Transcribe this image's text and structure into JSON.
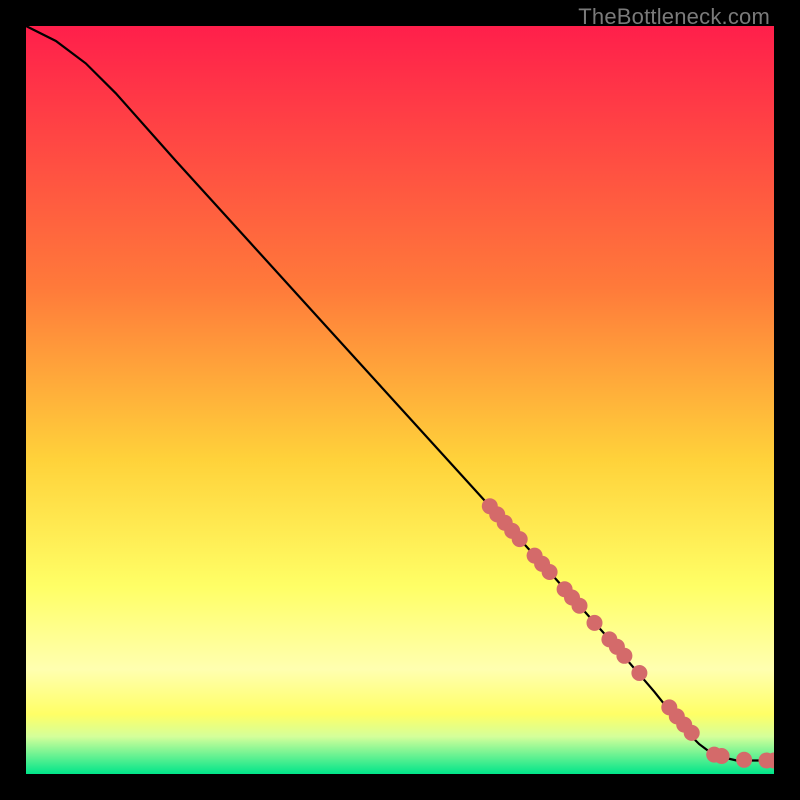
{
  "watermark": "TheBottleneck.com",
  "colors": {
    "top": "#ff1f4b",
    "mid1": "#ff7a3a",
    "mid2": "#ffd23a",
    "mid3": "#ffff66",
    "mid4": "#ffffb0",
    "edgeY": "#ffff66",
    "edgeG": "#d4ff9a",
    "bottom": "#00e58a",
    "line": "#000000",
    "marker": "#d46a6a"
  },
  "chart_data": {
    "type": "line",
    "title": "",
    "xlabel": "",
    "ylabel": "",
    "xlim": [
      0,
      100
    ],
    "ylim": [
      0,
      100
    ],
    "series": [
      {
        "name": "curve",
        "x": [
          0,
          4,
          8,
          12,
          20,
          30,
          40,
          50,
          60,
          70,
          78,
          84,
          88,
          90,
          92,
          95,
          100
        ],
        "y": [
          100,
          98,
          95,
          91,
          82,
          71,
          60,
          49,
          38,
          27,
          18,
          11,
          6,
          4,
          2.5,
          1.8,
          1.8
        ]
      }
    ],
    "markers": {
      "name": "segment",
      "x": [
        62,
        63,
        64,
        65,
        66,
        68,
        69,
        70,
        72,
        73,
        74,
        76,
        78,
        79,
        80,
        82,
        86,
        87,
        88,
        89,
        92,
        93,
        96,
        99,
        100
      ],
      "y": [
        35.8,
        34.7,
        33.6,
        32.5,
        31.4,
        29.2,
        28.1,
        27.0,
        24.7,
        23.6,
        22.5,
        20.2,
        18.0,
        17.0,
        15.8,
        13.5,
        8.9,
        7.7,
        6.6,
        5.5,
        2.6,
        2.4,
        1.9,
        1.8,
        1.8
      ]
    }
  }
}
